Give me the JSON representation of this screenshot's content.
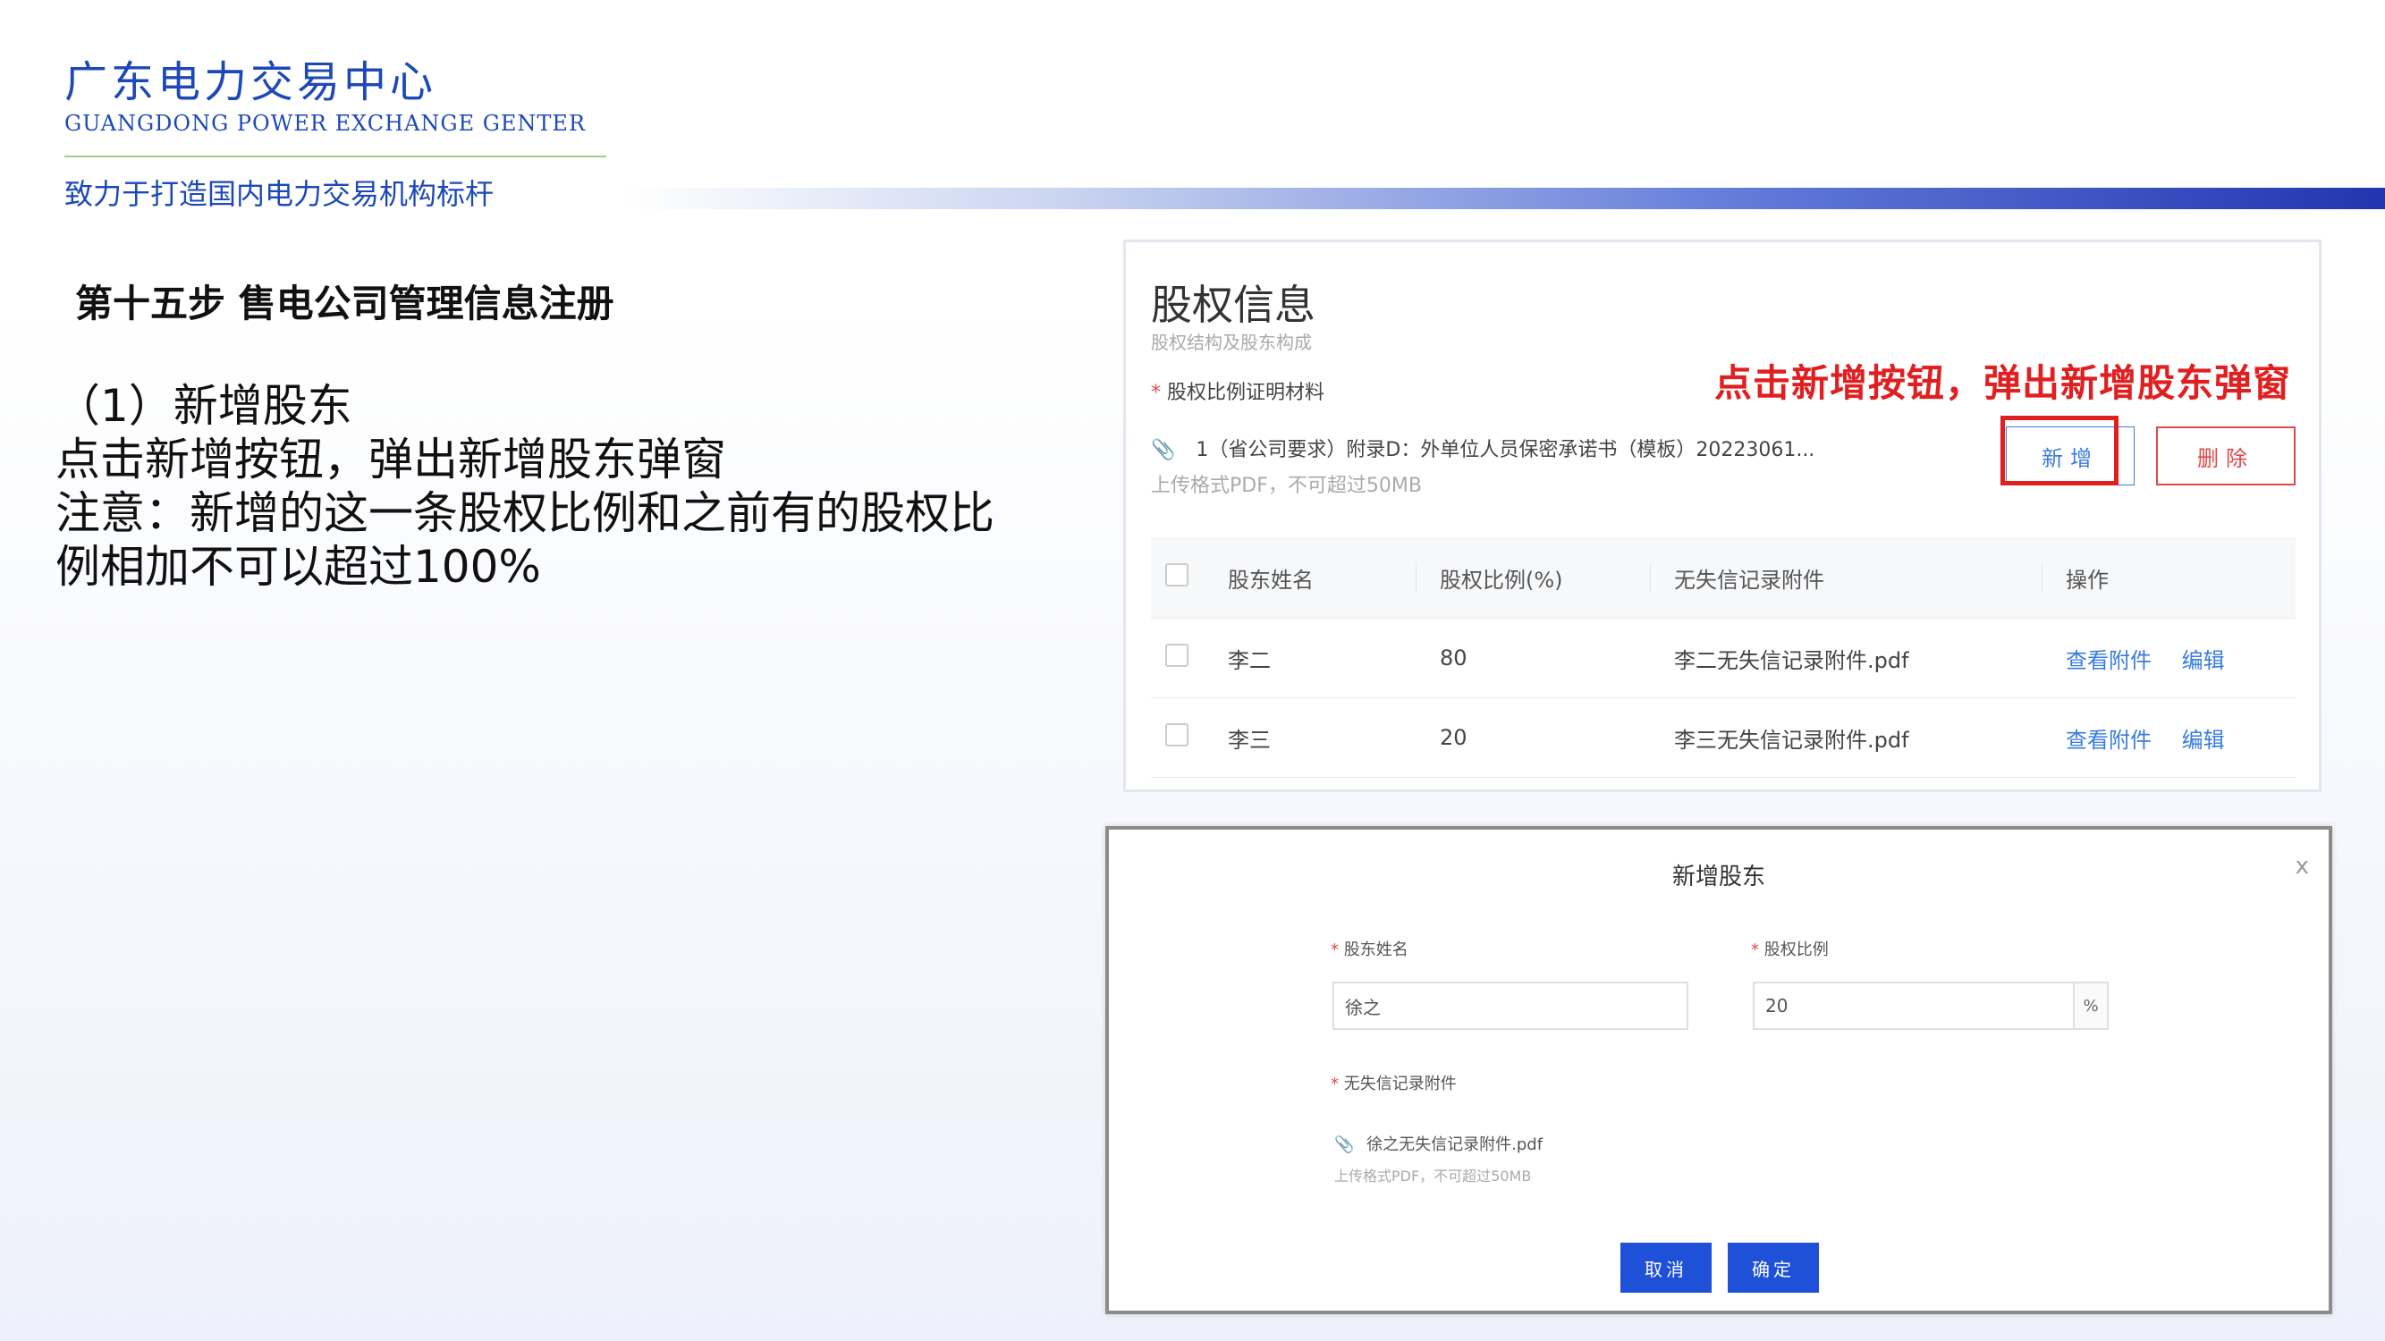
{
  "brand": {
    "title": "广东电力交易中心",
    "subtitle_en": "GUANGDONG POWER EXCHANGE GENTER",
    "slogan": "致力于打造国内电力交易机构标杆"
  },
  "step_title": "第十五步 售电公司管理信息注册",
  "instructions": [
    "（1）新增股东",
    "点击新增按钮，弹出新增股东弹窗",
    "注意：新增的这一条股权比例和之前有的股权比",
    "例相加不可以超过100%"
  ],
  "panel": {
    "title": "股权信息",
    "subtitle": "股权结构及股东构成",
    "required_mark": "*",
    "proof_label": "股权比例证明材料",
    "attachment_text": "1（省公司要求）附录D：外单位人员保密承诺书（模板）20223061...",
    "upload_hint": "上传格式PDF，不可超过50MB",
    "annotation": "点击新增按钮，弹出新增股东弹窗",
    "add_button": "新增",
    "delete_button": "删除",
    "table": {
      "headers": [
        "股东姓名",
        "股权比例(%)",
        "无失信记录附件",
        "操作"
      ],
      "rows": [
        {
          "name": "李二",
          "ratio": "80",
          "file": "李二无失信记录附件.pdf",
          "view": "查看附件",
          "edit": "编辑"
        },
        {
          "name": "李三",
          "ratio": "20",
          "file": "李三无失信记录附件.pdf",
          "view": "查看附件",
          "edit": "编辑"
        }
      ]
    }
  },
  "dialog": {
    "title": "新增股东",
    "close": "x",
    "name_label": "股东姓名",
    "name_value": "徐之",
    "ratio_label": "股权比例",
    "ratio_value": "20",
    "ratio_suffix": "%",
    "attach_label": "无失信记录附件",
    "file_name": "徐之无失信记录附件.pdf",
    "upload_hint": "上传格式PDF，不可超过50MB",
    "cancel_button": "取消",
    "confirm_button": "确定"
  }
}
